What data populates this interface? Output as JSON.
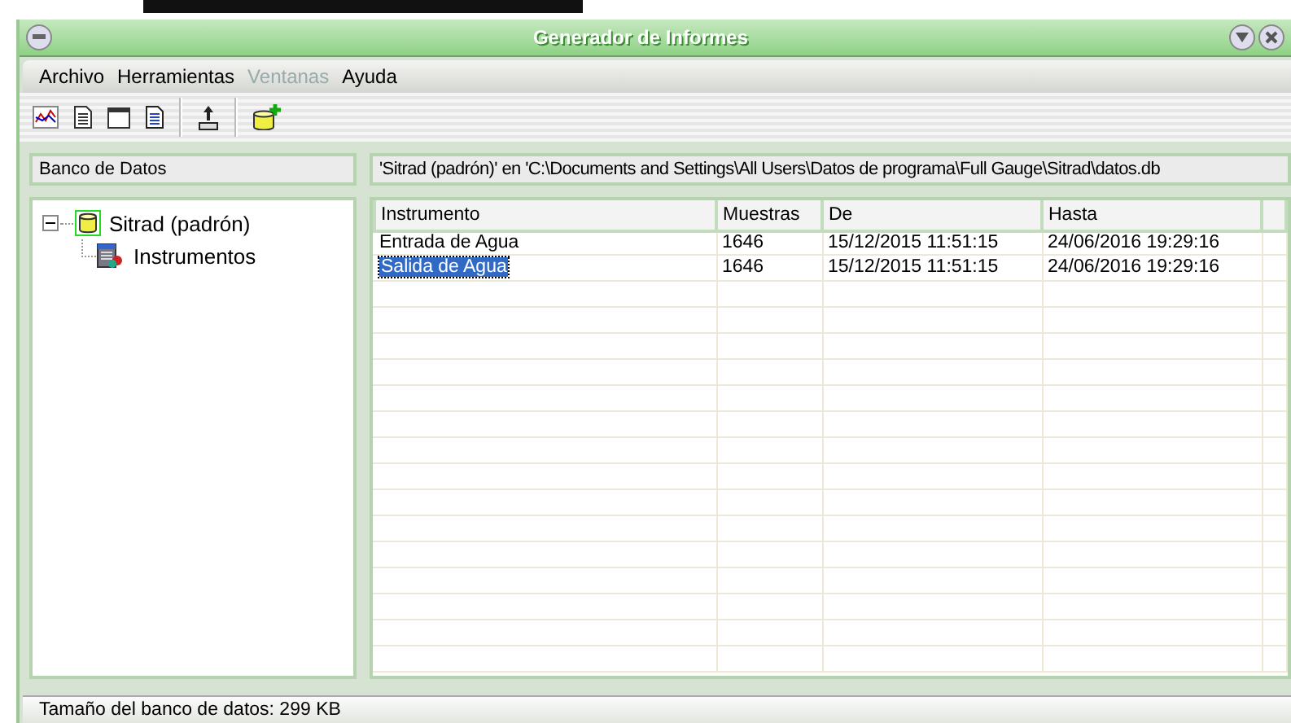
{
  "window": {
    "title": "Generador de Informes"
  },
  "menu": [
    {
      "label": "Archivo",
      "disabled": false
    },
    {
      "label": "Herramientas",
      "disabled": false
    },
    {
      "label": "Ventanas",
      "disabled": true
    },
    {
      "label": "Ayuda",
      "disabled": false
    }
  ],
  "toolbar": [
    {
      "kind": "chart"
    },
    {
      "kind": "doc"
    },
    {
      "kind": "window"
    },
    {
      "kind": "doc-blue"
    },
    {
      "kind": "sep"
    },
    {
      "kind": "export"
    },
    {
      "kind": "sep"
    },
    {
      "kind": "db-add"
    }
  ],
  "left_header": "Banco de Datos",
  "path_header": "'Sitrad (padrón)' en 'C:\\Documents and Settings\\All Users\\Datos de programa\\Full Gauge\\Sitrad\\datos.db",
  "tree": [
    {
      "label": "Sitrad (padrón)",
      "kind": "database",
      "expanded": true,
      "children": [
        {
          "label": "Instrumentos",
          "kind": "instruments"
        }
      ]
    }
  ],
  "table": {
    "columns": [
      "Instrumento",
      "Muestras",
      "De",
      "Hasta"
    ],
    "rows": [
      {
        "cells": [
          "Entrada de Agua",
          "1646",
          "15/12/2015 11:51:15",
          "24/06/2016 19:29:16"
        ],
        "selected": false
      },
      {
        "cells": [
          "Salida de Agua",
          "1646",
          "15/12/2015 11:51:15",
          "24/06/2016 19:29:16"
        ],
        "selected": true
      }
    ]
  },
  "status_bar": "Tamaño del banco de datos: 299 KB"
}
